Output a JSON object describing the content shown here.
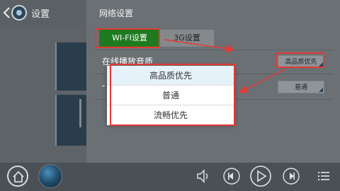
{
  "header": {
    "title": "设置"
  },
  "settings": {
    "title": "网络设置",
    "tabs": [
      {
        "label": "WI-FI设置",
        "active": true
      },
      {
        "label": "3G设置",
        "active": false
      }
    ],
    "online_quality_label": "在线播放音质",
    "online_quality_value": "高品质优先",
    "second_row_label": "-",
    "second_row_value": "普通"
  },
  "dropdown": {
    "options": [
      {
        "label": "高品质优先",
        "selected": true
      },
      {
        "label": "普通",
        "selected": false
      },
      {
        "label": "流畅优先",
        "selected": false
      }
    ]
  },
  "colors": {
    "accent_green": "#1f7a1f",
    "annotation_red": "#e53935",
    "dropdown_selected_bg": "#e6f2fa"
  },
  "player": {
    "icons": [
      "home-icon",
      "album-art",
      "volume-icon",
      "previous-icon",
      "play-icon",
      "next-icon",
      "playlist-icon"
    ]
  }
}
